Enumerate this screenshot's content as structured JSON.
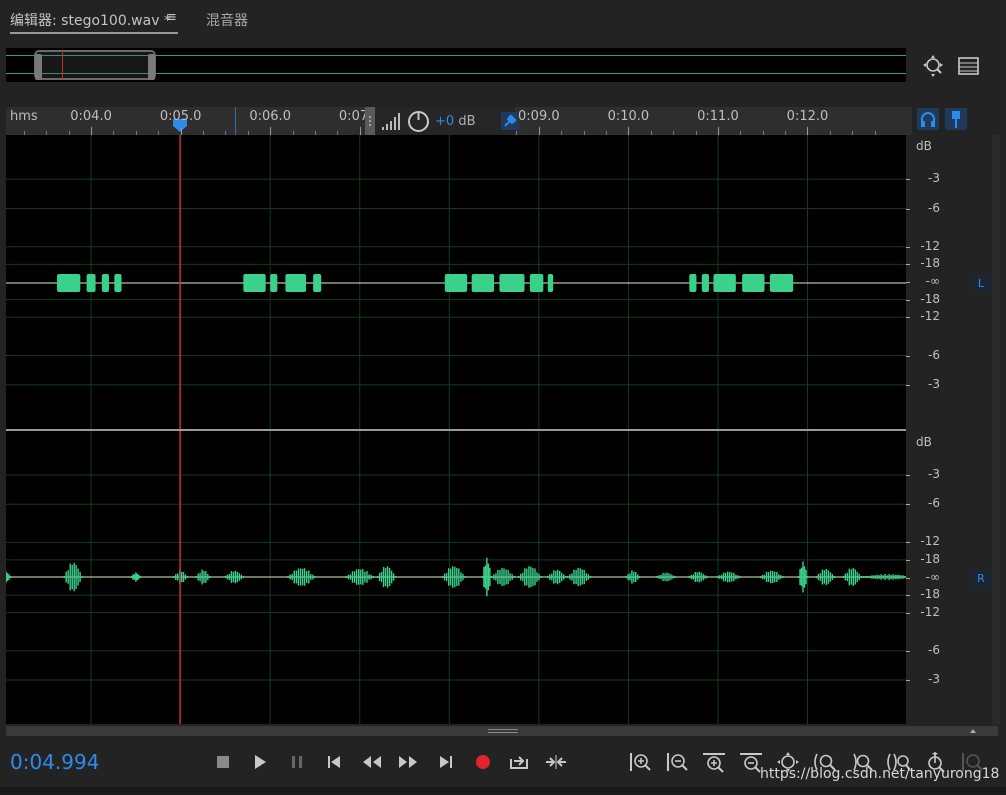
{
  "tabs": {
    "editor_label": "编辑器: stego100.wav *",
    "menu_icon": "≡",
    "mixer_label": "混音器"
  },
  "ruler": {
    "unit_label": "hms",
    "ticks": [
      "0:04.0",
      "0:05.0",
      "0:06.0",
      "0:07.0",
      "0:08.0",
      "0:09.0",
      "0:10.0",
      "0:11.0",
      "0:12.0"
    ]
  },
  "hud": {
    "gain_value": "+0",
    "gain_unit": "dB"
  },
  "db_scale": {
    "unit": "dB",
    "labels": [
      "-3",
      "-6",
      "-12",
      "-18",
      "-∞",
      "-18",
      "-12",
      "-6",
      "-3"
    ]
  },
  "channels": {
    "left_badge": "L",
    "right_badge": "R"
  },
  "transport": {
    "timecode": "0:04.994"
  },
  "watermark": "https://blog.csdn.net/tanyurong18",
  "colors": {
    "waveform": "#3ad28a",
    "playhead": "#c03030",
    "accent": "#2d8ceb",
    "record": "#e0242a"
  },
  "icons": {
    "zoom_tool": "zoom-tool-icon",
    "view_toggle": "spectral-view-icon",
    "headphone": "headphone-icon",
    "marker": "marker-icon",
    "pin": "pin-icon",
    "gain_knob": "gain-knob-icon",
    "stop": "stop-icon",
    "play": "play-icon",
    "pause": "pause-icon",
    "goto_start": "skip-to-start-icon",
    "rewind": "rewind-icon",
    "fast_forward": "fast-forward-icon",
    "goto_end": "skip-to-end-icon",
    "record": "record-icon",
    "loop": "loop-icon",
    "skip_selection": "skip-selection-icon"
  },
  "waveform": {
    "left_blocks_sec": [
      [
        3.62,
        3.88
      ],
      [
        3.95,
        4.05
      ],
      [
        4.12,
        4.2
      ],
      [
        4.26,
        4.34
      ],
      [
        5.7,
        5.95
      ],
      [
        6.0,
        6.08
      ],
      [
        6.17,
        6.4
      ],
      [
        6.48,
        6.57
      ],
      [
        7.95,
        8.2
      ],
      [
        8.25,
        8.5
      ],
      [
        8.56,
        8.84
      ],
      [
        8.9,
        9.05
      ],
      [
        9.1,
        9.16
      ],
      [
        10.68,
        10.76
      ],
      [
        10.82,
        10.9
      ],
      [
        10.95,
        11.2
      ],
      [
        11.27,
        11.52
      ],
      [
        11.58,
        11.84
      ]
    ],
    "right_bursts_sec": [
      [
        3.05,
        0.1,
        6
      ],
      [
        3.8,
        0.2,
        16
      ],
      [
        4.5,
        0.1,
        5
      ],
      [
        5.0,
        0.15,
        7
      ],
      [
        5.25,
        0.15,
        8
      ],
      [
        5.6,
        0.2,
        7
      ],
      [
        6.35,
        0.3,
        10
      ],
      [
        7.0,
        0.3,
        9
      ],
      [
        7.3,
        0.2,
        12
      ],
      [
        8.05,
        0.25,
        12
      ],
      [
        8.42,
        0.1,
        20
      ],
      [
        8.6,
        0.25,
        10
      ],
      [
        8.9,
        0.25,
        12
      ],
      [
        9.2,
        0.2,
        8
      ],
      [
        9.45,
        0.25,
        10
      ],
      [
        10.05,
        0.15,
        7
      ],
      [
        10.42,
        0.2,
        5
      ],
      [
        10.78,
        0.2,
        6
      ],
      [
        11.12,
        0.25,
        6
      ],
      [
        11.6,
        0.25,
        7
      ],
      [
        11.95,
        0.1,
        16
      ],
      [
        12.2,
        0.2,
        9
      ],
      [
        12.5,
        0.2,
        10
      ],
      [
        12.9,
        0.6,
        3
      ]
    ]
  },
  "time_axis": {
    "start_sec": 3.05,
    "end_sec": 13.1
  }
}
